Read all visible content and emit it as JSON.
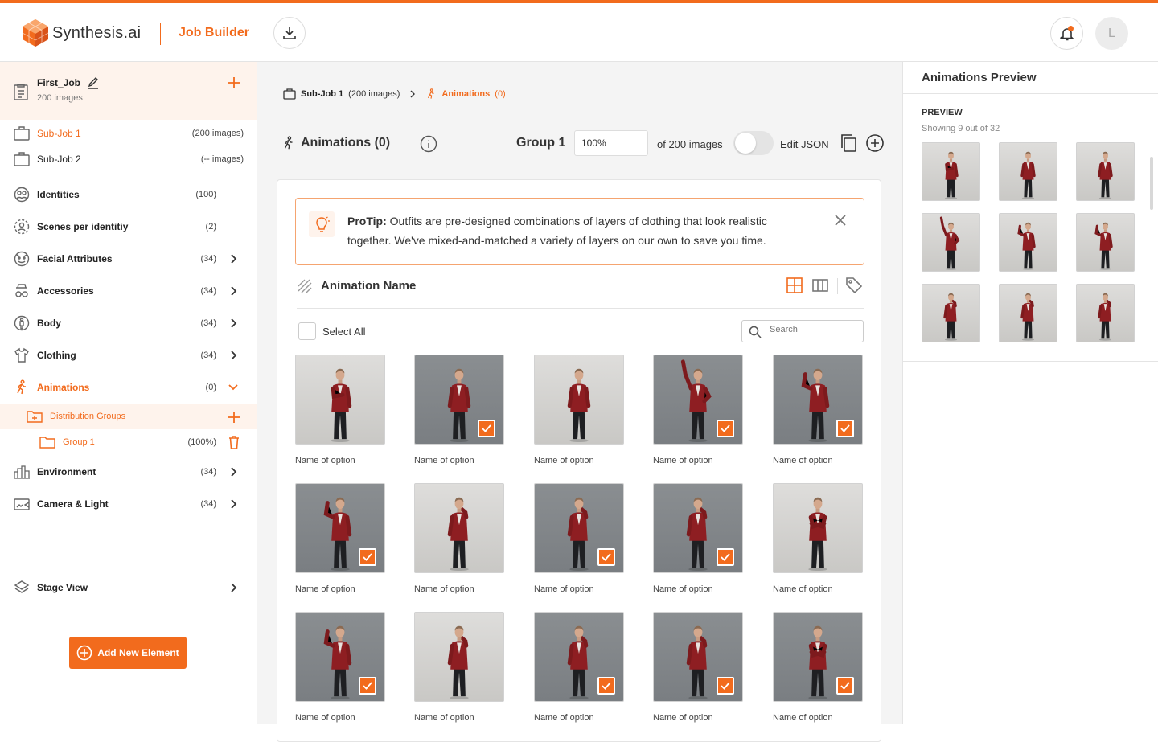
{
  "header": {
    "brand": "Synthesis.ai",
    "app_name": "Job Builder",
    "avatar_initial": "L"
  },
  "colors": {
    "accent": "#f26b1d",
    "accent_light": "#fef3ec"
  },
  "sidebar": {
    "job": {
      "name": "First_Job",
      "count": "200 images"
    },
    "items": [
      {
        "label": "Sub-Job 1",
        "count": "(200 images)",
        "icon": "briefcase-icon",
        "active": true
      },
      {
        "label": "Sub-Job 2",
        "count": "(-- images)",
        "icon": "briefcase-icon"
      },
      {
        "label": "Identities",
        "count": "(100)",
        "icon": "identities-icon"
      },
      {
        "label": "Scenes per identitiy",
        "count": "(2)",
        "icon": "scenes-icon"
      },
      {
        "label": "Facial Attributes",
        "count": "(34)",
        "icon": "face-icon"
      },
      {
        "label": "Accessories",
        "count": "(34)",
        "icon": "accessories-icon"
      },
      {
        "label": "Body",
        "count": "(34)",
        "icon": "body-icon"
      },
      {
        "label": "Clothing",
        "count": "(34)",
        "icon": "shirt-icon"
      },
      {
        "label": "Animations",
        "count": "(0)",
        "icon": "person-walk-icon",
        "expanded": true
      },
      {
        "label": "Distribution Groups",
        "icon": "folder-plus-icon"
      },
      {
        "label": "Group 1",
        "count": "(100%)",
        "icon": "folder-icon"
      },
      {
        "label": "Environment",
        "count": "(34)",
        "icon": "environment-icon"
      },
      {
        "label": "Camera & Light",
        "count": "(34)",
        "icon": "camera-icon"
      }
    ],
    "stage_view": "Stage View",
    "add_button": "Add New Element"
  },
  "breadcrumb": {
    "sub_job": "Sub-Job 1",
    "sub_job_count": "(200 images)",
    "current": "Animations",
    "current_count": "(0)"
  },
  "toolbar": {
    "title": "Animations (0)",
    "group": "Group 1",
    "percent": "100%",
    "of_images": "of 200 images",
    "edit_json": "Edit JSON",
    "edit_json_on": false
  },
  "protip": {
    "label": "ProTip:",
    "text": "Outfits are pre-designed combinations of layers of clothing that look realistic together. We've mixed-and-matched a variety of layers on our own to save you time."
  },
  "section": {
    "title": "Animation Name",
    "select_all": "Select All",
    "search_placeholder": "Search"
  },
  "options": [
    {
      "label": "Name of option",
      "checked": false,
      "bg": "light",
      "pose": "hand-chest"
    },
    {
      "label": "Name of option",
      "checked": true,
      "bg": "dark",
      "pose": "idle"
    },
    {
      "label": "Name of option",
      "checked": false,
      "bg": "light",
      "pose": "idle"
    },
    {
      "label": "Name of option",
      "checked": true,
      "bg": "dark",
      "pose": "wave-high"
    },
    {
      "label": "Name of option",
      "checked": true,
      "bg": "dark",
      "pose": "wave"
    },
    {
      "label": "Name of option",
      "checked": true,
      "bg": "dark",
      "pose": "wave"
    },
    {
      "label": "Name of option",
      "checked": false,
      "bg": "light",
      "pose": "hand-face"
    },
    {
      "label": "Name of option",
      "checked": true,
      "bg": "dark",
      "pose": "hand-face"
    },
    {
      "label": "Name of option",
      "checked": true,
      "bg": "dark",
      "pose": "hand-face"
    },
    {
      "label": "Name of option",
      "checked": false,
      "bg": "light",
      "pose": "arms-crossed"
    },
    {
      "label": "Name of option",
      "checked": true,
      "bg": "dark",
      "pose": "wave"
    },
    {
      "label": "Name of option",
      "checked": false,
      "bg": "light",
      "pose": "hand-face"
    },
    {
      "label": "Name of option",
      "checked": true,
      "bg": "dark",
      "pose": "hand-face"
    },
    {
      "label": "Name of option",
      "checked": true,
      "bg": "dark",
      "pose": "hand-face"
    },
    {
      "label": "Name of option",
      "checked": true,
      "bg": "dark",
      "pose": "arms-crossed"
    }
  ],
  "preview": {
    "title": "Animations Preview",
    "label": "PREVIEW",
    "showing": "Showing 9 out of 32",
    "items": [
      {
        "bg": "light",
        "pose": "hand-chest"
      },
      {
        "bg": "light",
        "pose": "idle"
      },
      {
        "bg": "light",
        "pose": "idle"
      },
      {
        "bg": "light",
        "pose": "wave-high"
      },
      {
        "bg": "light",
        "pose": "wave"
      },
      {
        "bg": "light",
        "pose": "wave"
      },
      {
        "bg": "light",
        "pose": "hand-face"
      },
      {
        "bg": "light",
        "pose": "hand-face"
      },
      {
        "bg": "light",
        "pose": "hand-face"
      }
    ]
  }
}
